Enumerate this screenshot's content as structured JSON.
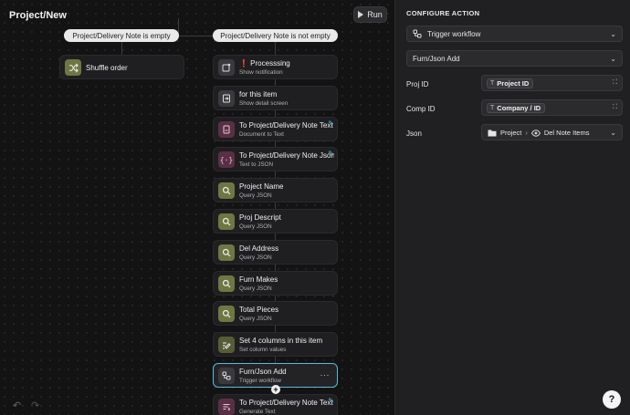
{
  "canvas": {
    "title": "Project/New",
    "run_label": "Run",
    "conditions": [
      "Project/Delivery Note is empty",
      "Project/Delivery Note is not empty"
    ],
    "left_branch": {
      "title": "Shuffle order",
      "icon": "shuffle-icon"
    },
    "nodes": [
      {
        "title": "❗ Processsing",
        "subtitle": "Show notification",
        "icon": "notification-icon",
        "color": "grey"
      },
      {
        "title": "for this item",
        "subtitle": "Show detail screen",
        "icon": "enter-screen-icon",
        "color": "grey"
      },
      {
        "title": "To Project/Delivery Note Text",
        "subtitle": "Document to Text",
        "icon": "document-icon",
        "color": "plum"
      },
      {
        "title": "To Project/Delivery Note Json",
        "subtitle": "Text to JSON",
        "icon": "braces-icon",
        "color": "plum"
      },
      {
        "title": "Project Name",
        "subtitle": "Query JSON",
        "icon": "search-icon",
        "color": "olive"
      },
      {
        "title": "Proj Descript",
        "subtitle": "Query JSON",
        "icon": "search-icon",
        "color": "olive"
      },
      {
        "title": "Del Address",
        "subtitle": "Query JSON",
        "icon": "search-icon",
        "color": "olive"
      },
      {
        "title": "Furn Makes",
        "subtitle": "Query JSON",
        "icon": "search-icon",
        "color": "olive"
      },
      {
        "title": "Total Pieces",
        "subtitle": "Query JSON",
        "icon": "search-icon",
        "color": "olive"
      },
      {
        "title": "Set 4 columns in this item",
        "subtitle": "Set column values",
        "icon": "edit-columns-icon",
        "color": "olive-dk"
      },
      {
        "title": "Furn/Json Add",
        "subtitle": "Trigger workflow",
        "icon": "workflow-icon",
        "color": "grey"
      },
      {
        "title": "To Project/Delivery Note Text",
        "subtitle": "Generate Text",
        "icon": "generate-text-icon",
        "color": "plum"
      }
    ]
  },
  "panel": {
    "title": "CONFIGURE ACTION",
    "action_type": "Trigger workflow",
    "workflow": "Furn/Json Add",
    "fields": [
      {
        "label": "Proj ID",
        "value": "Project ID"
      },
      {
        "label": "Comp ID",
        "value": "Company / ID"
      },
      {
        "label": "Json",
        "path_root": "Project",
        "path_leaf": "Del Note Items"
      }
    ],
    "help": "?"
  },
  "colors": {
    "accent": "#5bb9d8",
    "olive": "#6e7742",
    "plum": "#5a2f45"
  }
}
